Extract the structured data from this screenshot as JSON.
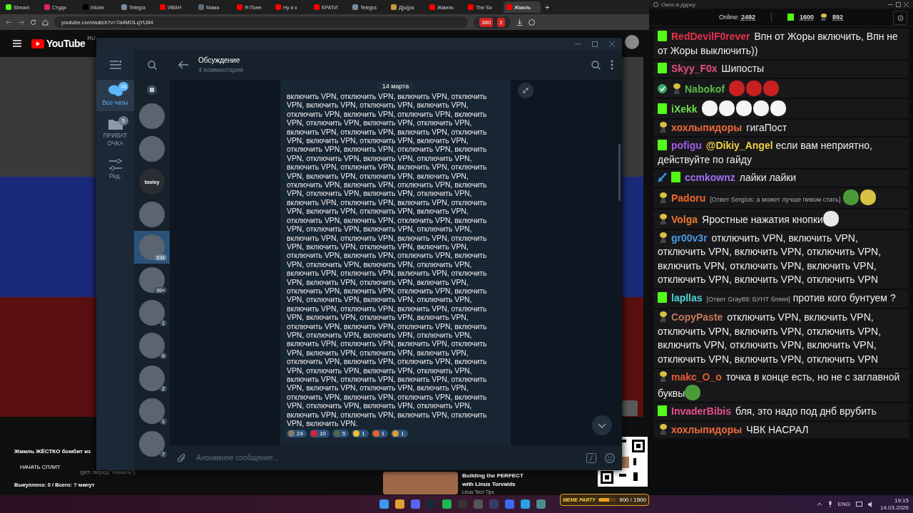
{
  "browser": {
    "tabs": [
      {
        "title": "Stream",
        "selected": false
      },
      {
        "title": "Студи",
        "selected": false
      },
      {
        "title": "Intoler",
        "selected": false
      },
      {
        "title": "Telegra",
        "selected": false
      },
      {
        "title": "ИВАН",
        "selected": false
      },
      {
        "title": "Мама",
        "selected": false
      },
      {
        "title": "Я Поен",
        "selected": false
      },
      {
        "title": "Ну и к",
        "selected": false
      },
      {
        "title": "БРАТИ",
        "selected": false
      },
      {
        "title": "Telegra",
        "selected": false
      },
      {
        "title": "Д[ы]ра",
        "selected": false
      },
      {
        "title": "Жмиль",
        "selected": false
      },
      {
        "title": "The Sa",
        "selected": false
      },
      {
        "title": "Жмиль",
        "selected": true
      }
    ],
    "new_tab": "+",
    "address": "youtube.com/watch?v=7a4MOLqYU84",
    "extension_badges": [
      "380",
      "2"
    ]
  },
  "youtube": {
    "logo": "YouTube",
    "region": "RU",
    "video_title": "Жмиль ЖЁСТКО бомбит из",
    "split_button": "НАЧАТЬ СПЛИТ",
    "split_hint": "(уст. перед \"Начать\")",
    "purchased": "Выкуплено: 0 / Всего: ? минут",
    "recommended": {
      "title": "Building the PERFECT with Linus Torvalds",
      "channel": "Linus Tech Tips"
    }
  },
  "telegram": {
    "folders": [
      {
        "label": "Все чаты",
        "kind": "chats",
        "badge": "16",
        "selected": true
      },
      {
        "label": "ПРИВАТ ОЧКА",
        "kind": "folder",
        "badge": "5",
        "selected": false
      },
      {
        "label": "Ред.",
        "kind": "edit",
        "selected": false
      }
    ],
    "chats": [
      {
        "selected": false
      },
      {
        "selected": false
      },
      {
        "label": "toolsy",
        "selected": false
      },
      {
        "selected": false
      },
      {
        "badge": "534",
        "selected": true
      },
      {
        "badge": "99+",
        "selected": false
      },
      {
        "badge": "1",
        "selected": false
      },
      {
        "badge": "9",
        "selected": false
      },
      {
        "badge": "2",
        "selected": false
      },
      {
        "badge": "1",
        "selected": false
      },
      {
        "badge": "7",
        "selected": false
      }
    ],
    "header": {
      "title": "Обсуждение",
      "subtitle": "4 комментария"
    },
    "date": "14 марта",
    "message": "включить VPN, отключить VPN, включить VPN, отключить VPN, включить VPN, отключить VPN, включить VPN, отключить VPN, включить VPN, отключить VPN, включить VPN, отключить VPN, включить VPN, отключить VPN, включить VPN, отключить VPN, включить VPN, отключить VPN, включить VPN, отключить VPN, включить VPN, отключить VPN, включить VPN, отключить VPN, включить VPN, отключить VPN, включить VPN, отключить VPN, включить VPN, отключить VPN, включить VPN, отключить VPN, включить VPN, отключить VPN, включить VPN, отключить VPN, включить VPN, отключить VPN, включить VPN, отключить VPN, включить VPN, отключить VPN, включить VPN, отключить VPN, включить VPN, отключить VPN, включить VPN, отключить VPN, включить VPN, отключить VPN, включить VPN, отключить VPN, включить VPN, отключить VPN, включить VPN, отключить VPN, включить VPN, отключить VPN, включить VPN, отключить VPN, включить VPN, отключить VPN, включить VPN, отключить VPN, включить VPN, отключить VPN, включить VPN, отключить VPN, включить VPN, отключить VPN, включить VPN, отключить VPN, включить VPN, отключить VPN, включить VPN, отключить VPN, включить VPN, отключить VPN, включить VPN, отключить VPN, включить VPN, отключить VPN, включить VPN, отключить VPN, включить VPN, отключить VPN, включить VPN, отключить VPN, включить VPN, отключить VPN, включить VPN, отключить VPN, включить VPN, отключить VPN, включить VPN, отключить VPN, включить VPN, отключить VPN, включить VPN, отключить VPN, включить VPN, отключить VPN, включить VPN, отключить VPN, включить VPN, отключить VPN, включить VPN, отключить VPN, включить VPN, отключить VPN, включить VPN, отключить VPN, включить VPN, отключить VPN, включить VPN, отключить VPN, включить VPN, отключить VPN, включить VPN, отключить VPN, включить VPN, отключить VPN, включить VPN, отключить VPN, включить VPN, отключить VPN, включить VPN, отключить VPN, включить VPN, отключить VPN, включить VPN.",
    "reactions": [
      {
        "count": "24"
      },
      {
        "count": "10"
      },
      {
        "count": "5"
      },
      {
        "count": "1"
      },
      {
        "count": "1"
      },
      {
        "count": "1"
      }
    ],
    "composer": {
      "placeholder": "Анонимное сообщение..."
    }
  },
  "stream_chat": {
    "window_title": "Окно в дурку",
    "online_label": "Online:",
    "online": "2492",
    "kick_count": "1600",
    "other_count": "892",
    "messages": [
      {
        "badges": [
          {
            "kind": "kick"
          }
        ],
        "user": "RedDevilF0rever",
        "color": "#e8304c",
        "text": "Впн от Жоры включить, Впн не от Жоры выключить))"
      },
      {
        "badges": [
          {
            "kind": "kick"
          }
        ],
        "user": "Skyy_F0x",
        "color": "#e8507c",
        "text": "Шипосты"
      },
      {
        "badges": [
          {
            "kind": "verified"
          },
          {
            "kind": "figure"
          }
        ],
        "user": "Nabokof",
        "color": "#5cb84a",
        "emotes": [
          {
            "kind": "ball"
          },
          {
            "kind": "ball"
          },
          {
            "kind": "ball"
          }
        ]
      },
      {
        "badges": [
          {
            "kind": "kick"
          }
        ],
        "user": "iXekk",
        "color": "#6edc4a",
        "emotes": [
          {
            "kind": "tooth"
          },
          {
            "kind": "tooth"
          },
          {
            "kind": "tooth"
          },
          {
            "kind": "tooth"
          },
          {
            "kind": "tooth"
          }
        ]
      },
      {
        "badges": [
          {
            "kind": "figure"
          }
        ],
        "user": "хохлыпидоры",
        "color": "#ec6a3a",
        "text": "гигаПост"
      },
      {
        "badges": [
          {
            "kind": "kick"
          }
        ],
        "user": "pofigu",
        "color": "#a45ce8",
        "mention": "@Dikiy_Angel",
        "text": "если вам неприятно, действуйте по гайду"
      },
      {
        "badges": [
          {
            "kind": "sword"
          },
          {
            "kind": "kick"
          }
        ],
        "user": "ccmkownz",
        "color": "#a070f0",
        "text": "лайки лайки"
      },
      {
        "badges": [
          {
            "kind": "figure"
          }
        ],
        "user": "Padoru",
        "color": "#f0682c",
        "reply": "[Ответ Sergius: а может лучше пивом стать]",
        "emotes": [
          {
            "kind": "frog"
          },
          {
            "kind": "figure"
          }
        ]
      },
      {
        "badges": [
          {
            "kind": "figure"
          }
        ],
        "user": "Volga",
        "color": "#ec782a",
        "text": "Яростные нажатия кнопки",
        "emotes": [
          {
            "kind": "mask"
          }
        ]
      },
      {
        "badges": [
          {
            "kind": "figure"
          }
        ],
        "user": "gr00v3r",
        "color": "#4a9ae6",
        "text": "отключить VPN, включить VPN, отключить VPN, включить VPN, отключить VPN, включить VPN, отключить VPN, включить VPN, отключить VPN, включить VPN, отключить VPN"
      },
      {
        "badges": [
          {
            "kind": "kick"
          }
        ],
        "user": "lapllas",
        "color": "#4cd2d2",
        "reply": "[Ответ Gray89: БУНТ бляяя]",
        "text": "против кого бунтуем ?"
      },
      {
        "badges": [
          {
            "kind": "figure"
          }
        ],
        "user": "CopyPaste",
        "color": "#c4785a",
        "text": "отключить VPN, включить VPN, отключить VPN, включить VPN, отключить VPN, включить VPN, отключить VPN, включить VPN, отключить VPN, включить VPN, отключить VPN"
      },
      {
        "badges": [
          {
            "kind": "figure"
          }
        ],
        "user": "makc_O_o",
        "color": "#e85a30",
        "text": "точка в конце есть, но не с заглавной буквы",
        "emotes": [
          {
            "kind": "frog"
          }
        ]
      },
      {
        "badges": [
          {
            "kind": "kick"
          }
        ],
        "user": "InvaderBibis",
        "color": "#e8508c",
        "text": "бля, это надо под днб врубить"
      },
      {
        "badges": [
          {
            "kind": "figure"
          }
        ],
        "user": "хохлыпидоры",
        "color": "#ec6a3a",
        "text": "ЧВК НАСРАЛ"
      }
    ]
  },
  "overlay": {
    "widget": "MEME PARTY",
    "progress": "900 / 1500",
    "level": 0.6
  },
  "taskbar": {
    "language": "ENG",
    "time": "19:15",
    "date": "14.03.2026"
  }
}
